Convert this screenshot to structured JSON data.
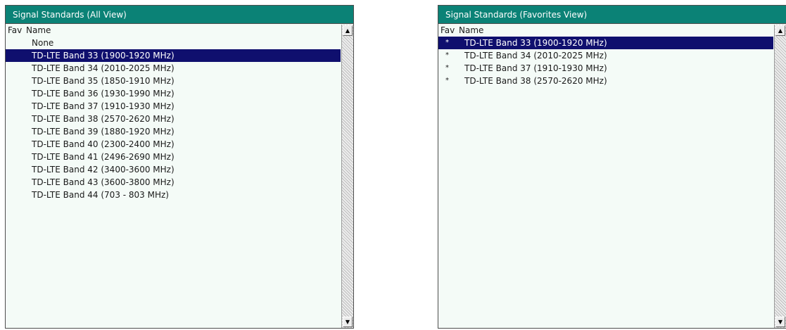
{
  "all_view": {
    "title": "Signal Standards (All View)",
    "col_fav": "Fav",
    "col_name": "Name",
    "items": [
      {
        "fav": "",
        "name": "None"
      },
      {
        "fav": "",
        "name": "TD-LTE Band 33 (1900-1920 MHz)"
      },
      {
        "fav": "",
        "name": "TD-LTE Band 34 (2010-2025 MHz)"
      },
      {
        "fav": "",
        "name": "TD-LTE Band 35 (1850-1910 MHz)"
      },
      {
        "fav": "",
        "name": "TD-LTE Band 36 (1930-1990 MHz)"
      },
      {
        "fav": "",
        "name": "TD-LTE Band 37 (1910-1930 MHz)"
      },
      {
        "fav": "",
        "name": "TD-LTE Band 38 (2570-2620 MHz)"
      },
      {
        "fav": "",
        "name": "TD-LTE Band 39 (1880-1920 MHz)"
      },
      {
        "fav": "",
        "name": "TD-LTE Band 40 (2300-2400 MHz)"
      },
      {
        "fav": "",
        "name": "TD-LTE Band 41 (2496-2690 MHz)"
      },
      {
        "fav": "",
        "name": "TD-LTE Band 42 (3400-3600 MHz)"
      },
      {
        "fav": "",
        "name": "TD-LTE Band 43 (3600-3800 MHz)"
      },
      {
        "fav": "",
        "name": "TD-LTE Band 44 (703 - 803 MHz)"
      }
    ],
    "selected_index": 1
  },
  "fav_view": {
    "title": "Signal Standards (Favorites View)",
    "col_fav": "Fav",
    "col_name": "Name",
    "items": [
      {
        "fav": "*",
        "name": "TD-LTE Band 33 (1900-1920 MHz)"
      },
      {
        "fav": "*",
        "name": "TD-LTE Band 34 (2010-2025 MHz)"
      },
      {
        "fav": "*",
        "name": "TD-LTE Band 37 (1910-1930 MHz)"
      },
      {
        "fav": "*",
        "name": "TD-LTE Band 38 (2570-2620 MHz)"
      }
    ],
    "selected_index": 0
  },
  "icons": {
    "scroll_up": "▲",
    "scroll_down": "▼"
  },
  "colors": {
    "title_bar": "#0b8276",
    "selection": "#0f0f6e",
    "list_background": "#f4fbf7"
  }
}
